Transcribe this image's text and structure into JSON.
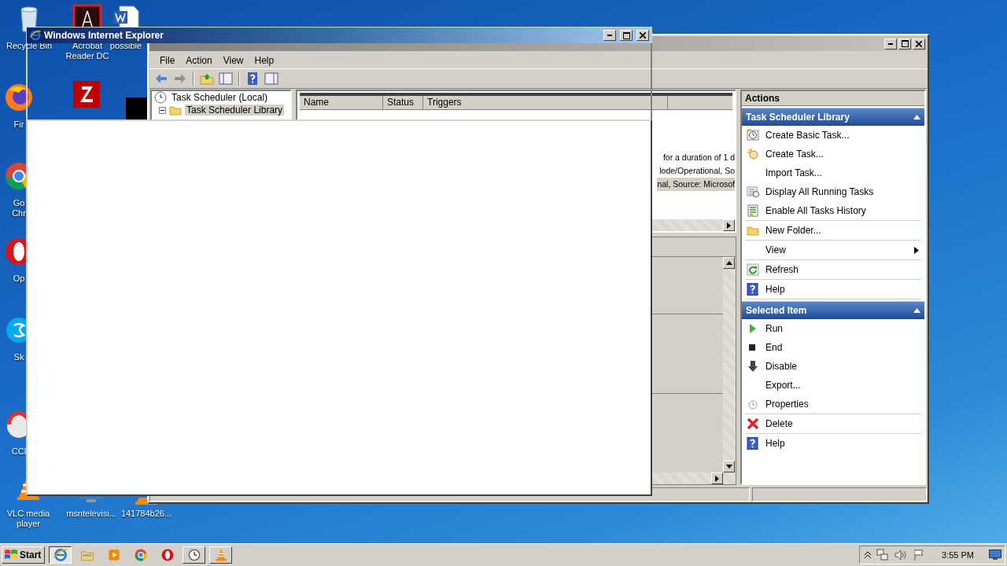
{
  "desktop_icons": [
    {
      "kind": "recycle",
      "label": "Recycle Bin"
    },
    {
      "kind": "acrobat",
      "label": "Acrobat Reader DC"
    },
    {
      "kind": "word",
      "label": "possible"
    },
    {
      "kind": "firefox",
      "label": "Fir"
    },
    {
      "kind": "filezilla"
    },
    {
      "kind": "dark-app"
    },
    {
      "kind": "chrome",
      "label": "Go Chr"
    },
    {
      "kind": "opera",
      "label": "Op"
    },
    {
      "kind": "skype",
      "label": "Sk"
    },
    {
      "kind": "ccleaner",
      "label": "CCl"
    },
    {
      "kind": "vlc",
      "label": "VLC media player"
    },
    {
      "kind": "monitor",
      "label": "msntelevisi..."
    },
    {
      "kind": "vlc",
      "label": "141784b26..."
    }
  ],
  "task_scheduler": {
    "menu": [
      "File",
      "Action",
      "View",
      "Help"
    ],
    "tree": [
      {
        "label": "Task Scheduler (Local)",
        "selected": false,
        "children": [
          {
            "label": "Task Scheduler Library",
            "selected": true,
            "expanded": true
          }
        ]
      }
    ],
    "columns": [
      "Name",
      "Status",
      "Triggers"
    ],
    "rows": [
      {
        "triggers": "for a duration of 1 d",
        "selected": false
      },
      {
        "triggers": "lode/Operational, So",
        "selected": false
      },
      {
        "triggers": "nal, Source: Microsof",
        "selected": true
      }
    ],
    "actions": {
      "title": "Actions",
      "sections": [
        {
          "title": "Task Scheduler Library",
          "expanded": true,
          "groups": [
            [
              {
                "label": "Create Basic Task...",
                "kind": "basic-task"
              },
              {
                "label": "Create Task...",
                "kind": "create-task"
              },
              {
                "label": "Import Task...",
                "kind": "plain"
              },
              {
                "label": "Display All Running Tasks",
                "kind": "running"
              },
              {
                "label": "Enable All Tasks History",
                "kind": "history"
              }
            ],
            [
              {
                "label": "New Folder...",
                "kind": "folder"
              }
            ],
            [
              {
                "label": "View",
                "kind": "plain",
                "submenu": true
              }
            ],
            [
              {
                "label": "Refresh",
                "kind": "refresh"
              }
            ],
            [
              {
                "label": "Help",
                "kind": "help"
              }
            ]
          ]
        },
        {
          "title": "Selected Item",
          "expanded": true,
          "groups": [
            [
              {
                "label": "Run",
                "kind": "run"
              },
              {
                "label": "End",
                "kind": "end"
              },
              {
                "label": "Disable",
                "kind": "disable"
              },
              {
                "label": "Export...",
                "kind": "plain"
              },
              {
                "label": "Properties",
                "kind": "properties"
              }
            ],
            [
              {
                "label": "Delete",
                "kind": "delete"
              }
            ],
            [
              {
                "label": "Help",
                "kind": "help"
              }
            ]
          ]
        }
      ]
    }
  },
  "browser": {
    "title": "Windows Internet Explorer"
  },
  "taskbar": {
    "start": "Start",
    "apps": [
      {
        "kind": "ie",
        "selected": true,
        "running": true
      },
      {
        "kind": "folder",
        "selected": false,
        "running": false
      },
      {
        "kind": "media",
        "selected": false,
        "running": false
      },
      {
        "kind": "chrome",
        "selected": false,
        "running": false
      },
      {
        "kind": "opera",
        "selected": false,
        "running": false
      },
      {
        "kind": "clock",
        "selected": false,
        "running": true
      },
      {
        "kind": "vlc",
        "selected": false,
        "running": true
      }
    ],
    "clock": "3:55 PM"
  }
}
